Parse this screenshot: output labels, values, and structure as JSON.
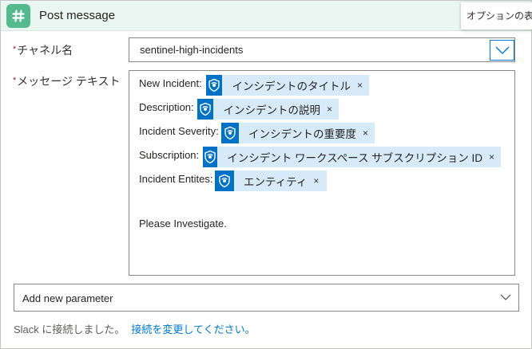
{
  "header": {
    "title": "Post message",
    "app_icon": "slack-hash-icon",
    "color": "#56b88f"
  },
  "tooltip": {
    "text": "オプションの表示"
  },
  "channel": {
    "label": "チャネル名",
    "required_mark": "*",
    "value": "sentinel-high-incidents",
    "dropdown_icon": "chevron-down-icon"
  },
  "message": {
    "label": "メッセージ テキスト",
    "required_mark": "*",
    "lines": [
      {
        "prefix": "New Incident:",
        "token": "インシデントのタイトル",
        "remove": "×"
      },
      {
        "prefix": "Description:",
        "token": "インシデントの説明",
        "remove": "×"
      },
      {
        "prefix": "Incident Severity:",
        "token": "インシデントの重要度",
        "remove": "×"
      },
      {
        "prefix": "Subscription:",
        "token": "インシデント ワークスペース サブスクリプション ID",
        "remove": "×"
      },
      {
        "prefix": "Incident Entites:",
        "token": "エンティティ",
        "remove": "×"
      }
    ],
    "trailing_text": "Please Investigate.",
    "token_icon": "sentinel-shield-icon",
    "token_icon_color": "#0072c6",
    "token_bg": "#d7eaf8"
  },
  "add_parameter": {
    "label": "Add new parameter",
    "icon": "chevron-down-icon"
  },
  "footer": {
    "status": "Slack に接続しました。",
    "link": "接続を変更してください。"
  }
}
